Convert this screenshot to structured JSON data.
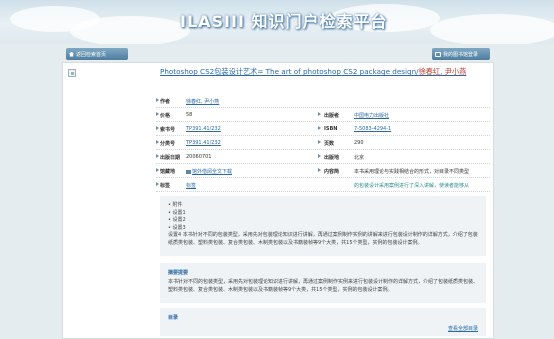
{
  "header": {
    "title": "ILASIII  知识门户检索平台",
    "back_label": "返回检索首页",
    "login_label": "我的图书馆登录"
  },
  "book": {
    "title": "Photoshop CS2包装设计艺术= The art of photoshop CS2 package design/",
    "authors": "徐春红, 尹小燕"
  },
  "meta": {
    "rows": [
      {
        "label": "作者",
        "value": "徐春红, 尹小燕",
        "value_link": true
      },
      {
        "label": "价格",
        "value": "58",
        "label2": "出版者",
        "value2": "中国电力出版社",
        "value2_link": true
      },
      {
        "label": "索书号",
        "value": "TP391.41/232",
        "value_link": true,
        "label2": "ISBN",
        "value2": "7-5083-4294-1",
        "value2_link": true
      },
      {
        "label": "分类号",
        "value": "TP391.41/232",
        "value_link": true,
        "label2": "页数",
        "value2": "290"
      },
      {
        "label": "出版日期",
        "value": "20060701",
        "label2": "出版地",
        "value2": "北京"
      },
      {
        "label": "馆藏地",
        "value": "馆外借阅全文下载",
        "value_link": true,
        "label2": "内容简",
        "value2": "本书采用理论与实践相结合的形式，对目录不同类型"
      },
      {
        "label": "标签",
        "value": "标签",
        "value_link": true,
        "label2": "",
        "value2": "的包装设计采用案例进行了深入讲解，使读者能够从",
        "value2_teal": true
      }
    ]
  },
  "contents": {
    "items": [
      "附件",
      "设置1",
      "设置2",
      "设置3"
    ],
    "long_item": "设置4 本书针对不同的包装类型，采用先对包装理论知识进行讲解，再通过案例制作实例的讲解来进行包装设计制作的详解方式，介绍了包装纸质类包装、塑料类包装、复合类包装、木制类包装以及书籍装帧等9个大类，共15个类型，实例的包装设计案例。"
  },
  "summary": {
    "title": "摘要提要",
    "text": "本书针对不同的包装类型，采用先对包装理论知识进行讲解，再通过案例制作实例来进行包装设计制作的详解方式，介绍了包装纸质类包装、塑料类包装、复合类包装、木制类包装以及书籍装帧等9个大类，共15个类型，实例的包装设计案例。"
  },
  "toc": {
    "title": "目录",
    "view_all": "查看全部目录"
  }
}
